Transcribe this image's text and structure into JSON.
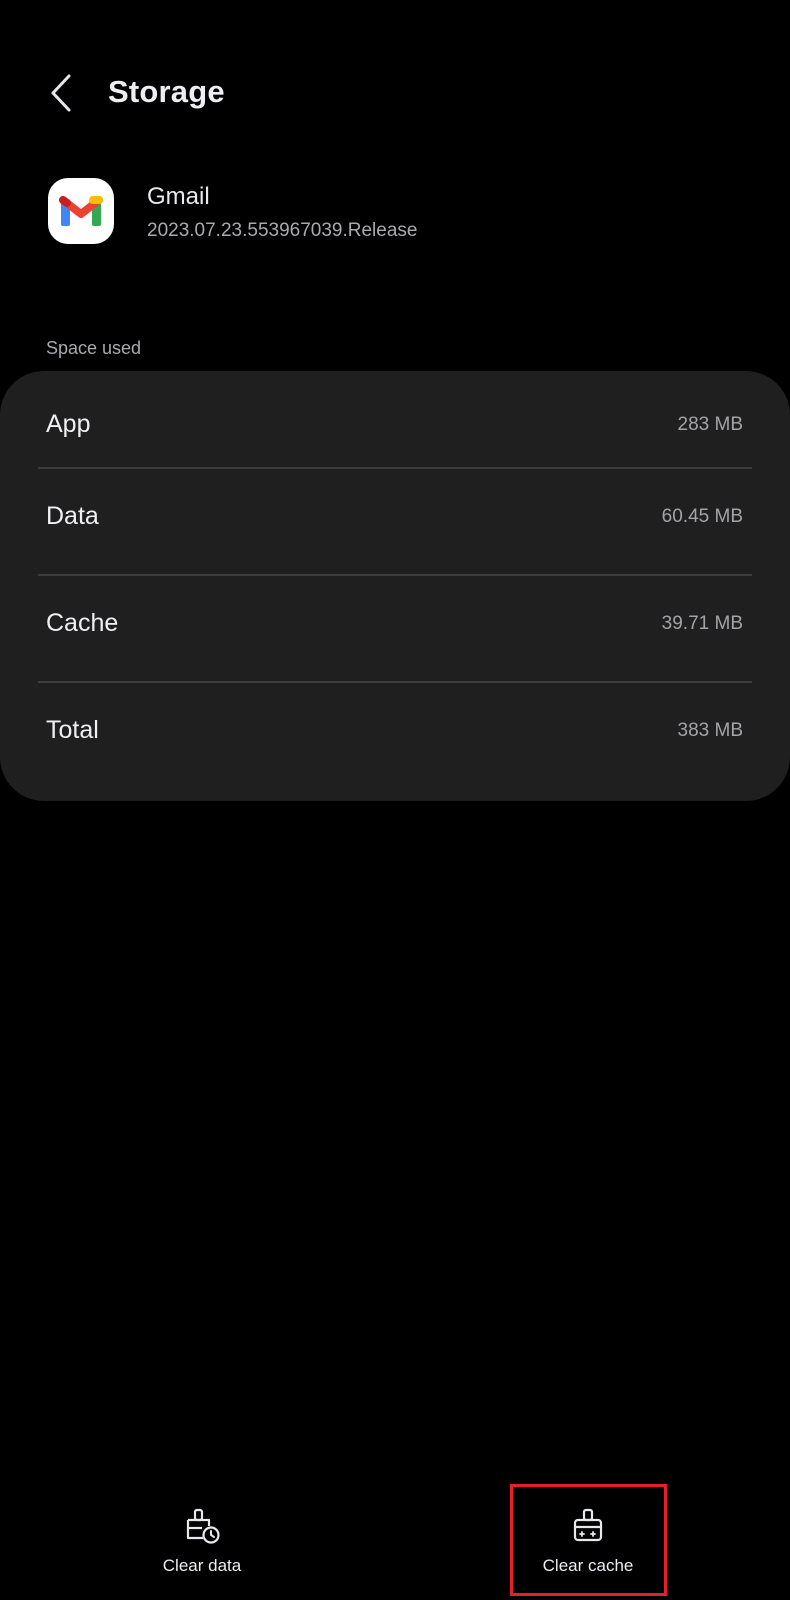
{
  "header": {
    "title": "Storage",
    "back_icon": "chevron-left-icon"
  },
  "app": {
    "name": "Gmail",
    "version": "2023.07.23.553967039.Release",
    "icon": "gmail-logo"
  },
  "space_used": {
    "label": "Space used",
    "rows": [
      {
        "label": "App",
        "value": "283 MB"
      },
      {
        "label": "Data",
        "value": "60.45 MB"
      },
      {
        "label": "Cache",
        "value": "39.71 MB"
      },
      {
        "label": "Total",
        "value": "383 MB"
      }
    ]
  },
  "actions": {
    "clear_data": {
      "label": "Clear data",
      "icon": "clear-data-icon"
    },
    "clear_cache": {
      "label": "Clear cache",
      "icon": "clear-cache-icon"
    }
  },
  "colors": {
    "background": "#000000",
    "card": "#1f1f1f",
    "highlight": "#e5202b"
  }
}
